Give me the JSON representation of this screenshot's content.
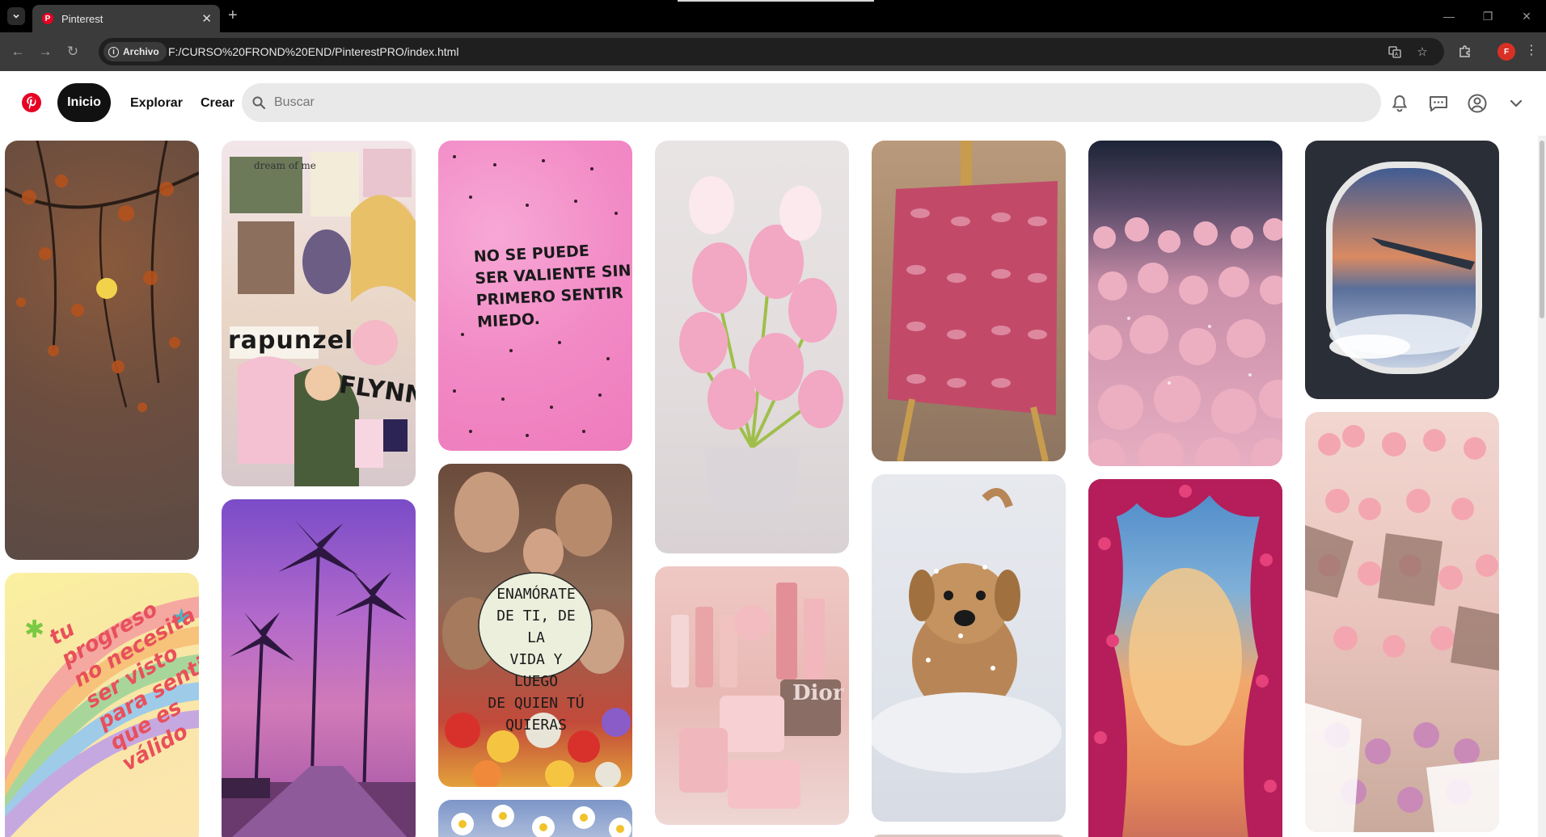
{
  "browser": {
    "tab_title": "Pinterest",
    "tab_favicon": "P",
    "new_tab": "+",
    "site_chip": "Archivo",
    "url": "F:/CURSO%20FROND%20END/PinterestPRO/index.html",
    "profile_initial": "F",
    "window_controls": [
      "—",
      "❐",
      "✕"
    ]
  },
  "header": {
    "home_label": "Inicio",
    "explore_label": "Explorar",
    "create_label": "Crear",
    "search_placeholder": "Buscar",
    "brand_color": "#e60023",
    "icons": [
      "pinterest-logo-icon",
      "bell-icon",
      "messages-icon",
      "account-icon",
      "chevron-down-icon"
    ]
  },
  "pins": [
    {
      "column": 1,
      "subject": "autumn-tree-moon"
    },
    {
      "column": 1,
      "subject": "rainbow-quote",
      "text": [
        "tu",
        "progreso",
        "no necesita",
        "ser visto",
        "para sentir",
        "que es",
        "válido"
      ]
    },
    {
      "column": 2,
      "subject": "rapunzel-collage",
      "text": [
        "dream of me",
        "rapunzel",
        "FLYNN"
      ]
    },
    {
      "column": 2,
      "subject": "palm-street-sunset"
    },
    {
      "column": 3,
      "subject": "pink-quote",
      "text": [
        "NO SE PUEDE",
        "SER VALIENTE SIN",
        "PRIMERO SENTIR",
        "MIEDO."
      ]
    },
    {
      "column": 3,
      "subject": "frida-collage",
      "text": [
        "ENAMÓRATE",
        "DE TI, DE LA",
        "VIDA Y LUEGO",
        "DE QUIEN TÚ",
        "QUIERAS"
      ]
    },
    {
      "column": 3,
      "subject": "daisies"
    },
    {
      "column": 4,
      "subject": "pink-tulips"
    },
    {
      "column": 4,
      "subject": "dior-makeup",
      "text": [
        "Dior"
      ]
    },
    {
      "column": 5,
      "subject": "lips-canvas"
    },
    {
      "column": 5,
      "subject": "snow-puppy"
    },
    {
      "column": 6,
      "subject": "rose-field"
    },
    {
      "column": 6,
      "subject": "bougainvillea-clouds"
    },
    {
      "column": 7,
      "subject": "airplane-window"
    },
    {
      "column": 7,
      "subject": "rose-bouquets"
    }
  ]
}
